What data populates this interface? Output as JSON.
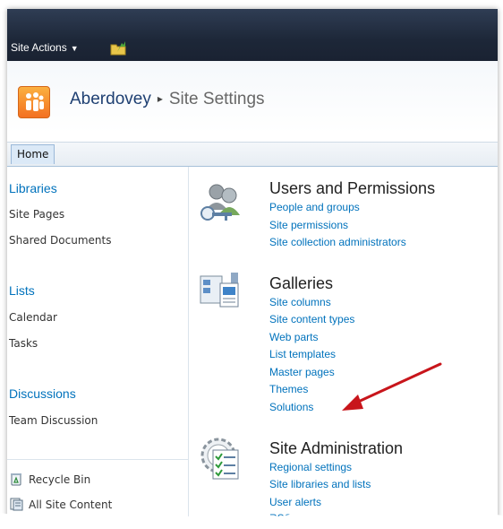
{
  "ribbon": {
    "site_actions_label": "Site Actions"
  },
  "breadcrumb": {
    "site_name": "Aberdovey",
    "page_name": "Site Settings"
  },
  "topnav": {
    "home_tab": "Home"
  },
  "quicklaunch": {
    "libraries": {
      "heading": "Libraries",
      "items": [
        "Site Pages",
        "Shared Documents"
      ]
    },
    "lists": {
      "heading": "Lists",
      "items": [
        "Calendar",
        "Tasks"
      ]
    },
    "discussions": {
      "heading": "Discussions",
      "items": [
        "Team Discussion"
      ]
    },
    "recycle_bin": "Recycle Bin",
    "all_site_content": "All Site Content"
  },
  "sections": {
    "users": {
      "title": "Users and Permissions",
      "links": [
        "People and groups",
        "Site permissions",
        "Site collection administrators"
      ]
    },
    "galleries": {
      "title": "Galleries",
      "links": [
        "Site columns",
        "Site content types",
        "Web parts",
        "List templates",
        "Master pages",
        "Themes",
        "Solutions"
      ]
    },
    "admin": {
      "title": "Site Administration",
      "links": [
        "Regional settings",
        "Site libraries and lists",
        "User alerts",
        "RSS"
      ]
    }
  },
  "colors": {
    "link": "#0072bc",
    "ribbon": "#1d2738",
    "annotation_arrow": "#c8151b",
    "logo": "#f37021"
  }
}
